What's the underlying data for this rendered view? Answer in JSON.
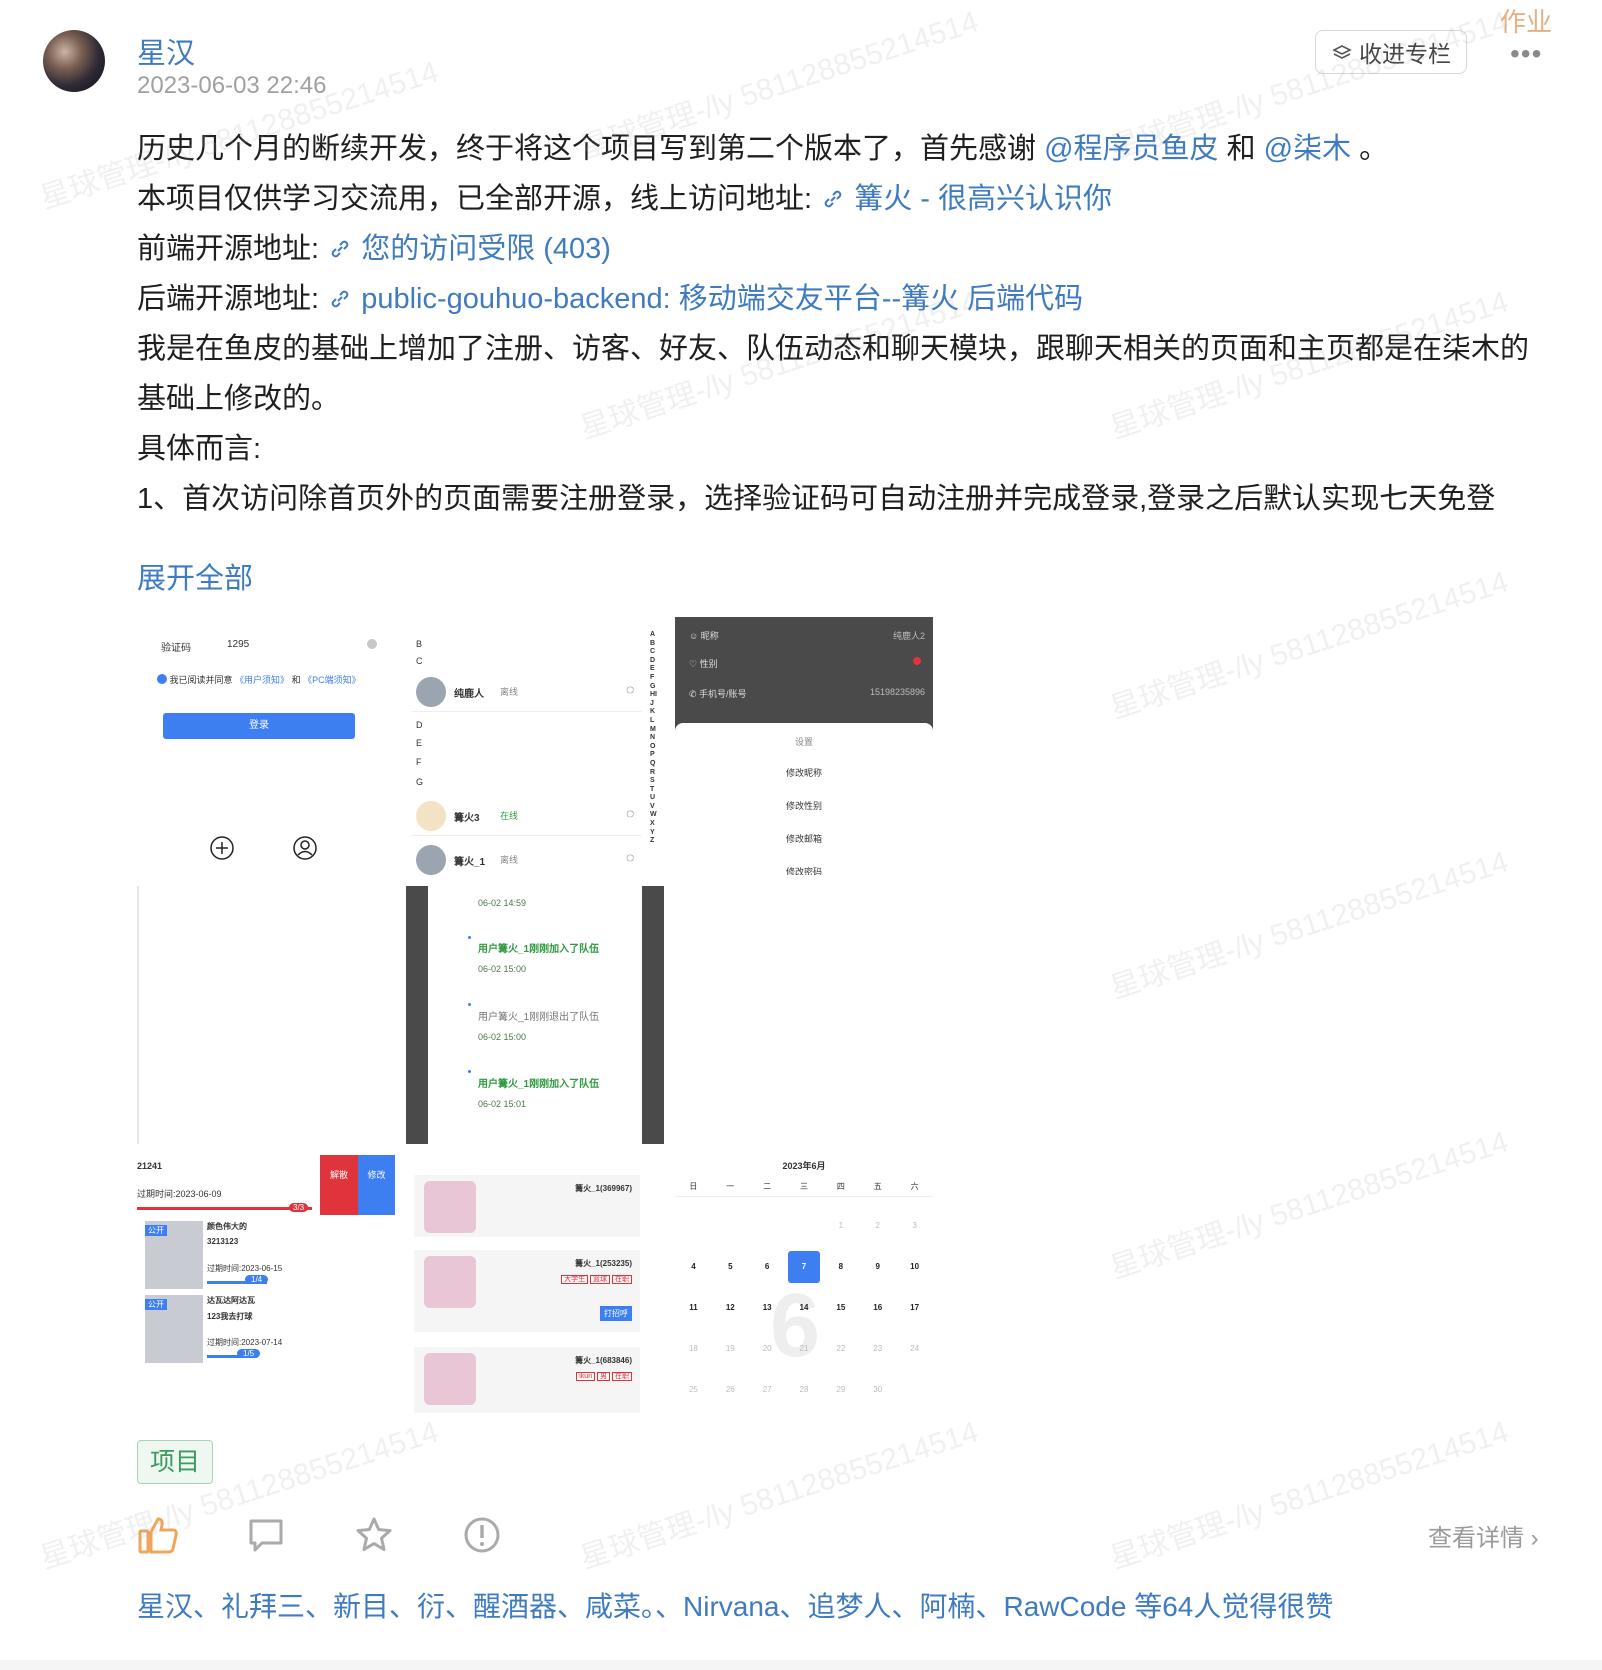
{
  "post": {
    "author": "星汉",
    "time": "2023-06-03 22:46",
    "collect_label": "收进专栏",
    "badge": "作业",
    "content": {
      "line1_pre": "历史几个月的断续开发，终于将这个项目写到第二个版本了，首先感谢 ",
      "mention1": "@程序员鱼皮",
      "line1_mid": "  和 ",
      "mention2": "@柒木",
      "line1_post": "  。",
      "line2_pre": "本项目仅供学习交流用，已全部开源，线上访问地址: ",
      "link1": "篝火 - 很高兴认识你",
      "line3_pre": "前端开源地址: ",
      "link2": "您的访问受限 (403)",
      "line4_pre": "后端开源地址: ",
      "link3": "public-gouhuo-backend: 移动端交友平台--篝火 后端代码",
      "line5": "我是在鱼皮的基础上增加了注册、访客、好友、队伍动态和聊天模块，跟聊天相关的页面和主页都是在柒木的基础上修改的。",
      "line6": "具体而言:",
      "line7": "1、首次访问除首页外的页面需要注册登录，选择验证码可自动注册并完成登录,登录之后默认实现七天免登"
    },
    "expand_label": "展开全部",
    "images": {
      "login": {
        "code_label": "验证码",
        "code_value": "1295",
        "agree_text": "我已阅读并同意",
        "agree_link1": "《用户须知》",
        "agree_and": "和",
        "agree_link2": "《PC端须知》",
        "login_button": "登录"
      },
      "contacts": {
        "letters_left": [
          "B",
          "C",
          "D",
          "E",
          "F",
          "G"
        ],
        "index_letters": "ABCDEFGHIJKLMNOPQRSTUVWXYZ",
        "rows": [
          {
            "name": "纯鹿人",
            "status": "离线"
          },
          {
            "name": "篝火3",
            "status": "在线"
          },
          {
            "name": "篝火_1",
            "status": "离线"
          }
        ]
      },
      "settings": {
        "rows": [
          {
            "label": "昵称",
            "value": "纯鹿人2"
          },
          {
            "label": "性别",
            "value": ""
          },
          {
            "label": "手机号/账号",
            "value": "15198235896"
          }
        ],
        "sheet_title": "设置",
        "items": [
          "修改昵称",
          "修改性别",
          "修改邮箱",
          "修改密码"
        ]
      },
      "timeline": {
        "entries": [
          {
            "text": "",
            "time": "06-02 14:59"
          },
          {
            "text": "用户篝火_1刚刚加入了队伍",
            "time": "06-02 15:00"
          },
          {
            "text": "用户篝火_1刚刚退出了队伍",
            "time": "06-02 15:00"
          },
          {
            "text": "用户篝火_1刚刚加入了队伍",
            "time": "06-02 15:01"
          }
        ]
      },
      "teams": {
        "header_num": "21241",
        "expire": "过期时间:2023-06-09",
        "progress": "3/3",
        "btn_dissolve": "解散",
        "btn_edit": "修改",
        "items": [
          {
            "badge": "公开",
            "name": "颜色伟大的",
            "desc": "3213123",
            "expire": "过期时间:2023-06-15",
            "progress": "1/4"
          },
          {
            "badge": "公开",
            "name": "达瓦达阿达瓦",
            "desc": "123我去打球",
            "expire": "过期时间:2023-07-14",
            "progress": "1/5"
          }
        ]
      },
      "users": {
        "items": [
          {
            "name": "篝火_1(369967)",
            "tags": []
          },
          {
            "name": "篝火_1(253235)",
            "tags": [
              "大学生",
              "篮球",
              "在职"
            ],
            "button": "打招呼"
          },
          {
            "name": "篝火_1(683846)",
            "tags": [
              "ikun",
              "男",
              "在职"
            ]
          }
        ]
      },
      "calendar": {
        "title": "2023年6月",
        "weekdays": [
          "日",
          "一",
          "二",
          "三",
          "四",
          "五",
          "六"
        ],
        "weeks": [
          [
            "",
            "",
            "",
            "",
            "1",
            "2",
            "3"
          ],
          [
            "4",
            "5",
            "6",
            "7",
            "8",
            "9",
            "10"
          ],
          [
            "11",
            "12",
            "13",
            "14",
            "15",
            "16",
            "17"
          ],
          [
            "18",
            "19",
            "20",
            "21",
            "22",
            "23",
            "24"
          ],
          [
            "25",
            "26",
            "27",
            "28",
            "29",
            "30",
            ""
          ]
        ],
        "selected": "7",
        "big_number": "6"
      }
    },
    "tag_label": "项目",
    "detail_label": "查看详情",
    "likes_text": "星汉、礼拜三、新目、衍、醒酒器、咸菜。、Nirvana、追梦人、阿楠、RawCode 等64人觉得很赞",
    "watermark": "星球管理-/ly 5811288552145​14"
  },
  "colors": {
    "link": "#3f7bc0",
    "accent_blue": "#3d7ff0",
    "red": "#e0343d",
    "green": "#2e9a3f"
  }
}
